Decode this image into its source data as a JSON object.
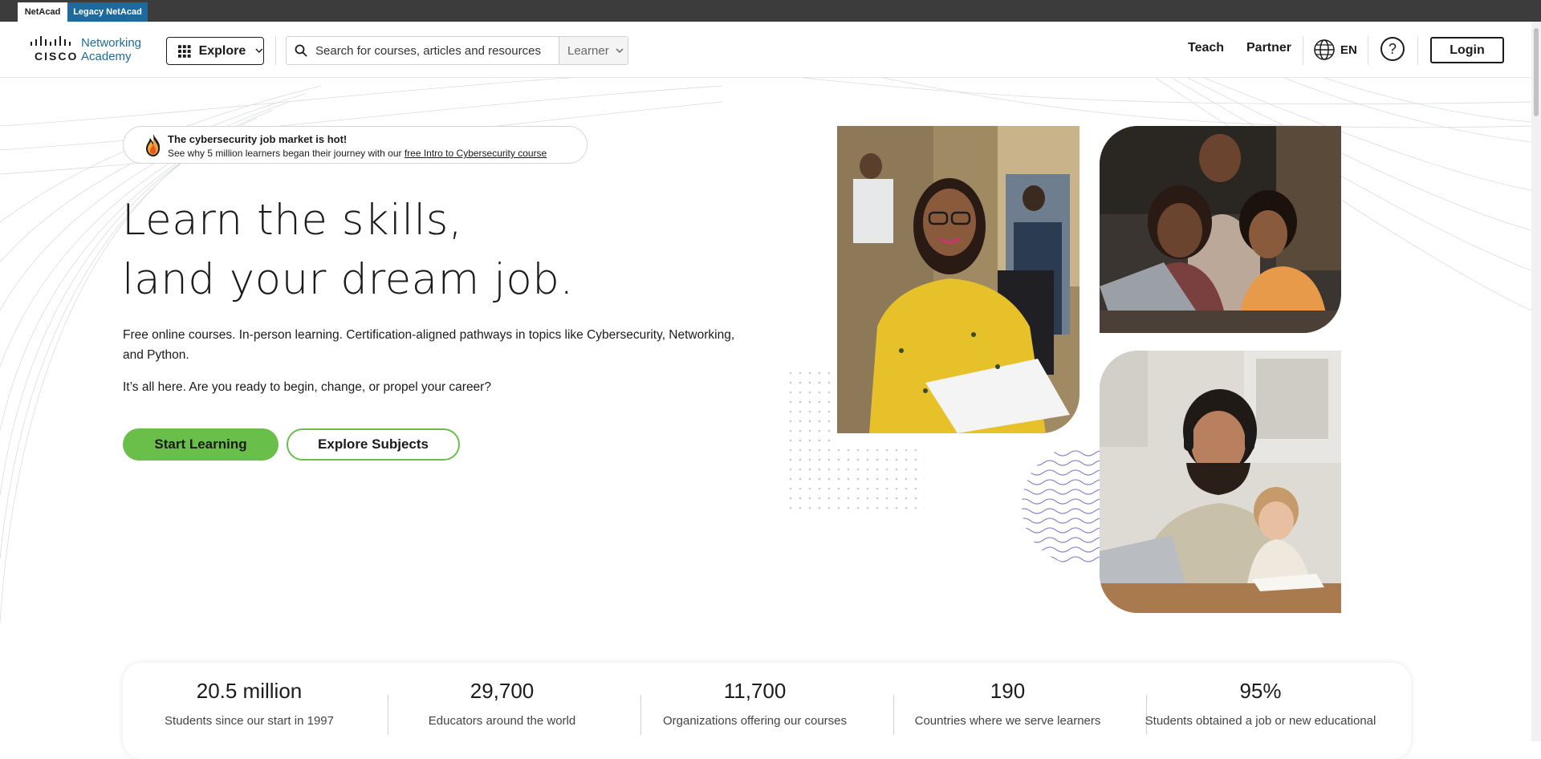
{
  "top_tabs": [
    "NetAcad",
    "Legacy NetAcad"
  ],
  "logo": {
    "brand": "CISCO",
    "line1": "Networking",
    "line2": "Academy"
  },
  "header": {
    "explore_label": "Explore",
    "search_placeholder": "Search for courses, articles and resources",
    "role_select": "Learner",
    "teach": "Teach",
    "partner": "Partner",
    "language": "EN",
    "help": "?",
    "login": "Login"
  },
  "promo": {
    "headline": "The cybersecurity job market is hot!",
    "text": "See why 5 million learners began their journey with our ",
    "link": "free Intro to Cybersecurity course"
  },
  "hero": {
    "line1": "Learn the skills,",
    "line2": "land your dream job.",
    "lead": "Free online courses. In-person learning. Certification-aligned pathways in topics like Cybersecurity, Networking, and Python.",
    "lead2": "It’s all here. Are you ready to begin, change, or propel your career?",
    "cta_primary": "Start Learning",
    "cta_secondary": "Explore Subjects"
  },
  "stats": [
    {
      "value": "20.5 million",
      "label": "Students since our start in 1997"
    },
    {
      "value": "29,700",
      "label": "Educators around the world"
    },
    {
      "value": "11,700",
      "label": "Organizations offering our courses"
    },
    {
      "value": "190",
      "label": "Countries where we serve learners"
    },
    {
      "value": "95%",
      "label": "Students obtained a job or new educational"
    }
  ],
  "colors": {
    "accent_green": "#6abf4b",
    "brand_blue": "#1e6a9c",
    "top_bar": "#3c3c3c"
  }
}
